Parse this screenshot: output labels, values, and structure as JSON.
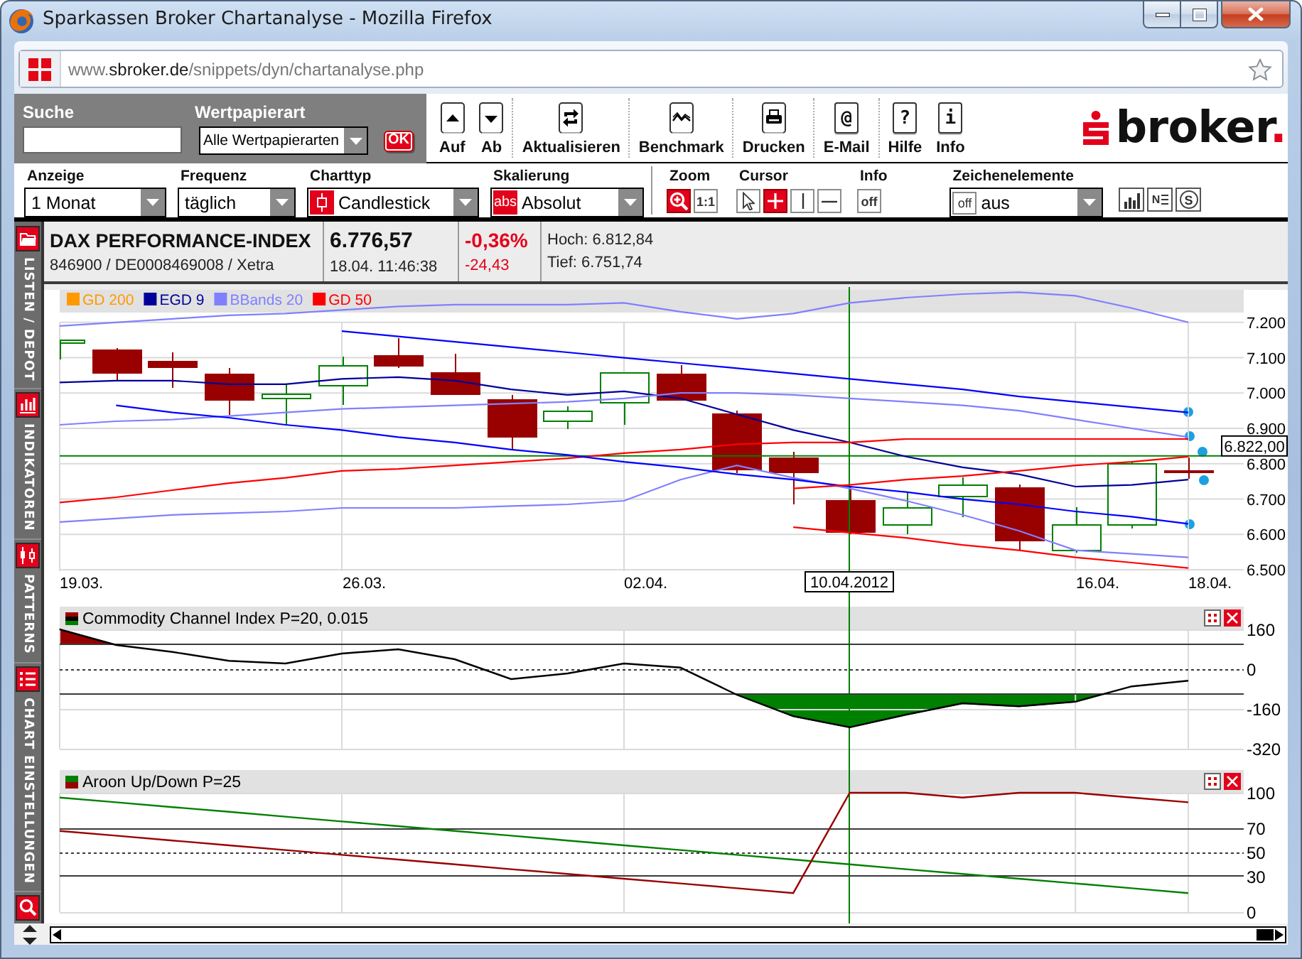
{
  "window": {
    "title": "Sparkassen Broker Chartanalyse - Mozilla Firefox"
  },
  "address_bar": {
    "url_prefix": "www.",
    "url_domain": "sbroker.de",
    "url_path": "/snippets/dyn/chartanalyse.php"
  },
  "search_panel": {
    "search_label": "Suche",
    "type_label": "Wertpapierart",
    "type_value": "Alle Wertpapierarten",
    "ok_button": "OK"
  },
  "toolbar": {
    "groups": [
      [
        {
          "kind": "up",
          "label": "Auf"
        },
        {
          "kind": "down",
          "label": "Ab"
        }
      ],
      [
        {
          "kind": "refresh",
          "label": "Aktualisieren"
        }
      ],
      [
        {
          "kind": "benchmark",
          "label": "Benchmark"
        }
      ],
      [
        {
          "kind": "print",
          "label": "Drucken"
        }
      ],
      [
        {
          "kind": "email",
          "glyph": "@",
          "label": "E-Mail"
        }
      ],
      [
        {
          "kind": "help",
          "glyph": "?",
          "label": "Hilfe"
        },
        {
          "kind": "info",
          "glyph": "i",
          "label": "Info"
        }
      ]
    ]
  },
  "logo": {
    "text": "broker",
    "dot": "."
  },
  "chart_settings": {
    "selects": [
      {
        "kind": "plain",
        "label": "Anzeige",
        "value": "1 Monat"
      },
      {
        "kind": "plain",
        "label": "Frequenz",
        "value": "täglich"
      },
      {
        "kind": "candlestick",
        "label": "Charttyp",
        "value": "Candlestick"
      },
      {
        "kind": "badge",
        "label": "Skalierung",
        "badge": "abs",
        "value": "Absolut"
      }
    ],
    "zoom": {
      "label": "Zoom",
      "tools": [
        {
          "kind": "zoom-in",
          "selected": true
        },
        {
          "kind": "reset",
          "text": "1:1",
          "selected": false
        }
      ]
    },
    "cursor": {
      "label": "Cursor",
      "tools": [
        {
          "kind": "pointer",
          "selected": false
        },
        {
          "kind": "crosshair",
          "selected": true
        },
        {
          "kind": "vertical",
          "selected": false
        },
        {
          "kind": "horizontal",
          "selected": false
        }
      ]
    },
    "info": {
      "label": "Info",
      "toggle": "off"
    },
    "drawing_elements": {
      "label": "Zeichenelemente",
      "toggle": "off",
      "value": "aus"
    },
    "view_tools": [
      {
        "kind": "bars"
      },
      {
        "kind": "news",
        "glyph": "N"
      },
      {
        "kind": "circle",
        "glyph": "S"
      }
    ]
  },
  "sidebar": {
    "tabs": [
      {
        "kind": "folder",
        "label": "LISTEN / DEPOT"
      },
      {
        "kind": "indicators",
        "label": "INDIKATOREN"
      },
      {
        "kind": "patterns",
        "label": "PATTERNS"
      },
      {
        "kind": "settings",
        "label": "CHART EINSTELLUNGEN"
      }
    ]
  },
  "instrument": {
    "name": "DAX PERFORMANCE-INDEX",
    "identifiers": "846900 / DE0008469008 / Xetra",
    "price": "6.776,57",
    "time": "18.04. 11:46:38",
    "change_percent": "-0,36%",
    "change": "-24,43",
    "high": "Hoch: 6.812,84",
    "low": "Tief: 6.751,74"
  },
  "main_chart": {
    "legend": [
      {
        "label": "GD 200",
        "color": "#ff9900"
      },
      {
        "label": "EGD 9",
        "color": "#000099"
      },
      {
        "label": "BBands 20",
        "color": "#8080ff"
      },
      {
        "label": "GD 50",
        "color": "#ff0000"
      }
    ],
    "chart_data": {
      "type": "line",
      "grid": true,
      "ylim": [
        6500,
        7300
      ],
      "yticks": [
        {
          "value": 7200,
          "label": "7.200"
        },
        {
          "value": 7100,
          "label": "7.100"
        },
        {
          "value": 7000,
          "label": "7.000"
        },
        {
          "value": 6900,
          "label": "6.900"
        },
        {
          "value": 6800,
          "label": "6.800"
        },
        {
          "value": 6700,
          "label": "6.700"
        },
        {
          "value": 6600,
          "label": "6.600"
        },
        {
          "value": 6500,
          "label": "6.500"
        }
      ],
      "categories": [
        "19.03.",
        null,
        null,
        null,
        null,
        "26.03.",
        null,
        null,
        null,
        null,
        "02.04.",
        null,
        null,
        null,
        null,
        null,
        null,
        null,
        "16.04.",
        null,
        "18.04."
      ],
      "ref_lines": [
        {
          "axis": "y",
          "value": 6822,
          "label": "6.822,00"
        }
      ],
      "series": [
        {
          "color": "#000099",
          "values": [
            7030,
            7035,
            7035,
            7025,
            7025,
            7040,
            7045,
            7035,
            7010,
            6995,
            7005,
            6985,
            6940,
            6895,
            6860,
            6820,
            6790,
            6770,
            6735,
            6740,
            6755
          ]
        },
        {
          "color": "#8080ff",
          "values": [
            7190,
            7200,
            7210,
            7220,
            7225,
            7235,
            7245,
            7250,
            7250,
            7250,
            7255,
            7230,
            7210,
            7225,
            7255,
            7270,
            7280,
            7285,
            7275,
            7240,
            7200
          ]
        },
        {
          "color": "#8080ff",
          "values": [
            6910,
            6920,
            6925,
            6935,
            6945,
            6955,
            6960,
            6965,
            6970,
            6975,
            6985,
            7000,
            7000,
            6995,
            6985,
            6975,
            6965,
            6950,
            6925,
            6900,
            6875
          ]
        },
        {
          "color": "#8080ff",
          "values": [
            6635,
            6645,
            6655,
            6660,
            6665,
            6675,
            6675,
            6675,
            6680,
            6685,
            6695,
            6755,
            6795,
            6760,
            6730,
            6695,
            6655,
            6610,
            6555,
            6545,
            6535
          ]
        },
        {
          "color": "#ff0000",
          "values": [
            6690,
            6705,
            6725,
            6745,
            6760,
            6780,
            6785,
            6795,
            6805,
            6815,
            6830,
            6840,
            6855,
            6860,
            6860,
            6870,
            6870,
            6870,
            6870,
            6870,
            6870
          ]
        },
        {
          "color": "#0000ff",
          "values": [
            null,
            null,
            null,
            null,
            null,
            7175,
            7160,
            7145,
            7130,
            7115,
            7100,
            7085,
            7070,
            7055,
            7040,
            7025,
            7010,
            6990,
            6975,
            6960,
            6945
          ]
        },
        {
          "color": "#0000ff",
          "values": [
            null,
            6965,
            6945,
            6930,
            6910,
            6895,
            6875,
            6860,
            6840,
            6825,
            6805,
            6790,
            6770,
            6755,
            6735,
            6720,
            6700,
            6685,
            6665,
            6650,
            6630
          ]
        },
        {
          "color": "#ff0000",
          "values": [
            null,
            null,
            null,
            null,
            null,
            null,
            null,
            null,
            null,
            null,
            null,
            null,
            null,
            6730,
            6740,
            6755,
            6765,
            6780,
            6795,
            6805,
            6820
          ]
        },
        {
          "color": "#ff0000",
          "values": [
            null,
            null,
            null,
            null,
            null,
            null,
            null,
            null,
            null,
            null,
            null,
            null,
            null,
            6620,
            6605,
            6590,
            6570,
            6555,
            6535,
            6520,
            6505
          ]
        }
      ]
    },
    "cursor_date": "10.04.2012"
  },
  "indicators": [
    {
      "chart_data": {
        "type": "line",
        "title": "Commodity Channel Index P=20, 0.015",
        "grid": true,
        "ylim": [
          -320,
          160
        ],
        "yticks": [
          160,
          0,
          -160,
          -320
        ],
        "ref_lines": [
          {
            "axis": "y",
            "value": 100
          },
          {
            "axis": "y",
            "value": 0
          },
          {
            "axis": "y",
            "value": -100
          }
        ],
        "series": [
          {
            "color": "#000000",
            "values": [
              160,
              97,
              69,
              34,
              23,
              63,
              80,
              40,
              -40,
              -17,
              23,
              6,
              -103,
              -189,
              -234,
              -183,
              -137,
              -149,
              -131,
              -69,
              -46
            ]
          }
        ]
      }
    },
    {
      "chart_data": {
        "type": "line",
        "title": "Aroon Up/Down P=25",
        "grid": true,
        "ylim": [
          0,
          100
        ],
        "yticks": [
          100,
          70,
          50,
          30,
          0
        ],
        "ref_lines": [
          {
            "axis": "y",
            "value": 70
          },
          {
            "axis": "y",
            "value": 50
          },
          {
            "axis": "y",
            "value": 30
          }
        ],
        "series": [
          {
            "color": "#008000",
            "values": [
              96,
              92,
              88,
              84,
              80,
              76,
              72,
              68,
              64,
              60,
              56,
              52,
              48,
              44,
              40,
              36,
              32,
              28,
              24,
              20,
              16
            ]
          },
          {
            "color": "#990000",
            "values": [
              68,
              64,
              60,
              56,
              52,
              48,
              44,
              40,
              36,
              32,
              28,
              24,
              20,
              16,
              100,
              100,
              96,
              100,
              100,
              96,
              92
            ]
          }
        ]
      }
    }
  ]
}
